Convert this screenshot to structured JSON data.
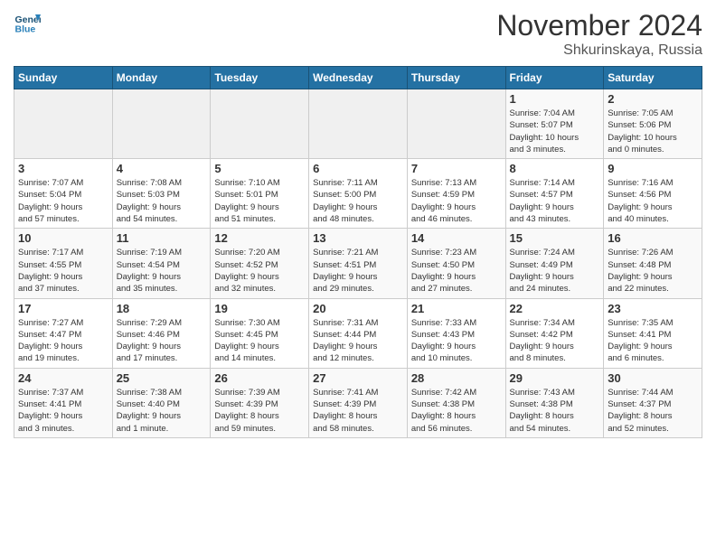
{
  "header": {
    "logo_line1": "General",
    "logo_line2": "Blue",
    "month": "November 2024",
    "location": "Shkurinskaya, Russia"
  },
  "days_of_week": [
    "Sunday",
    "Monday",
    "Tuesday",
    "Wednesday",
    "Thursday",
    "Friday",
    "Saturday"
  ],
  "weeks": [
    [
      {
        "day": "",
        "info": ""
      },
      {
        "day": "",
        "info": ""
      },
      {
        "day": "",
        "info": ""
      },
      {
        "day": "",
        "info": ""
      },
      {
        "day": "",
        "info": ""
      },
      {
        "day": "1",
        "info": "Sunrise: 7:04 AM\nSunset: 5:07 PM\nDaylight: 10 hours\nand 3 minutes."
      },
      {
        "day": "2",
        "info": "Sunrise: 7:05 AM\nSunset: 5:06 PM\nDaylight: 10 hours\nand 0 minutes."
      }
    ],
    [
      {
        "day": "3",
        "info": "Sunrise: 7:07 AM\nSunset: 5:04 PM\nDaylight: 9 hours\nand 57 minutes."
      },
      {
        "day": "4",
        "info": "Sunrise: 7:08 AM\nSunset: 5:03 PM\nDaylight: 9 hours\nand 54 minutes."
      },
      {
        "day": "5",
        "info": "Sunrise: 7:10 AM\nSunset: 5:01 PM\nDaylight: 9 hours\nand 51 minutes."
      },
      {
        "day": "6",
        "info": "Sunrise: 7:11 AM\nSunset: 5:00 PM\nDaylight: 9 hours\nand 48 minutes."
      },
      {
        "day": "7",
        "info": "Sunrise: 7:13 AM\nSunset: 4:59 PM\nDaylight: 9 hours\nand 46 minutes."
      },
      {
        "day": "8",
        "info": "Sunrise: 7:14 AM\nSunset: 4:57 PM\nDaylight: 9 hours\nand 43 minutes."
      },
      {
        "day": "9",
        "info": "Sunrise: 7:16 AM\nSunset: 4:56 PM\nDaylight: 9 hours\nand 40 minutes."
      }
    ],
    [
      {
        "day": "10",
        "info": "Sunrise: 7:17 AM\nSunset: 4:55 PM\nDaylight: 9 hours\nand 37 minutes."
      },
      {
        "day": "11",
        "info": "Sunrise: 7:19 AM\nSunset: 4:54 PM\nDaylight: 9 hours\nand 35 minutes."
      },
      {
        "day": "12",
        "info": "Sunrise: 7:20 AM\nSunset: 4:52 PM\nDaylight: 9 hours\nand 32 minutes."
      },
      {
        "day": "13",
        "info": "Sunrise: 7:21 AM\nSunset: 4:51 PM\nDaylight: 9 hours\nand 29 minutes."
      },
      {
        "day": "14",
        "info": "Sunrise: 7:23 AM\nSunset: 4:50 PM\nDaylight: 9 hours\nand 27 minutes."
      },
      {
        "day": "15",
        "info": "Sunrise: 7:24 AM\nSunset: 4:49 PM\nDaylight: 9 hours\nand 24 minutes."
      },
      {
        "day": "16",
        "info": "Sunrise: 7:26 AM\nSunset: 4:48 PM\nDaylight: 9 hours\nand 22 minutes."
      }
    ],
    [
      {
        "day": "17",
        "info": "Sunrise: 7:27 AM\nSunset: 4:47 PM\nDaylight: 9 hours\nand 19 minutes."
      },
      {
        "day": "18",
        "info": "Sunrise: 7:29 AM\nSunset: 4:46 PM\nDaylight: 9 hours\nand 17 minutes."
      },
      {
        "day": "19",
        "info": "Sunrise: 7:30 AM\nSunset: 4:45 PM\nDaylight: 9 hours\nand 14 minutes."
      },
      {
        "day": "20",
        "info": "Sunrise: 7:31 AM\nSunset: 4:44 PM\nDaylight: 9 hours\nand 12 minutes."
      },
      {
        "day": "21",
        "info": "Sunrise: 7:33 AM\nSunset: 4:43 PM\nDaylight: 9 hours\nand 10 minutes."
      },
      {
        "day": "22",
        "info": "Sunrise: 7:34 AM\nSunset: 4:42 PM\nDaylight: 9 hours\nand 8 minutes."
      },
      {
        "day": "23",
        "info": "Sunrise: 7:35 AM\nSunset: 4:41 PM\nDaylight: 9 hours\nand 6 minutes."
      }
    ],
    [
      {
        "day": "24",
        "info": "Sunrise: 7:37 AM\nSunset: 4:41 PM\nDaylight: 9 hours\nand 3 minutes."
      },
      {
        "day": "25",
        "info": "Sunrise: 7:38 AM\nSunset: 4:40 PM\nDaylight: 9 hours\nand 1 minute."
      },
      {
        "day": "26",
        "info": "Sunrise: 7:39 AM\nSunset: 4:39 PM\nDaylight: 8 hours\nand 59 minutes."
      },
      {
        "day": "27",
        "info": "Sunrise: 7:41 AM\nSunset: 4:39 PM\nDaylight: 8 hours\nand 58 minutes."
      },
      {
        "day": "28",
        "info": "Sunrise: 7:42 AM\nSunset: 4:38 PM\nDaylight: 8 hours\nand 56 minutes."
      },
      {
        "day": "29",
        "info": "Sunrise: 7:43 AM\nSunset: 4:38 PM\nDaylight: 8 hours\nand 54 minutes."
      },
      {
        "day": "30",
        "info": "Sunrise: 7:44 AM\nSunset: 4:37 PM\nDaylight: 8 hours\nand 52 minutes."
      }
    ]
  ]
}
